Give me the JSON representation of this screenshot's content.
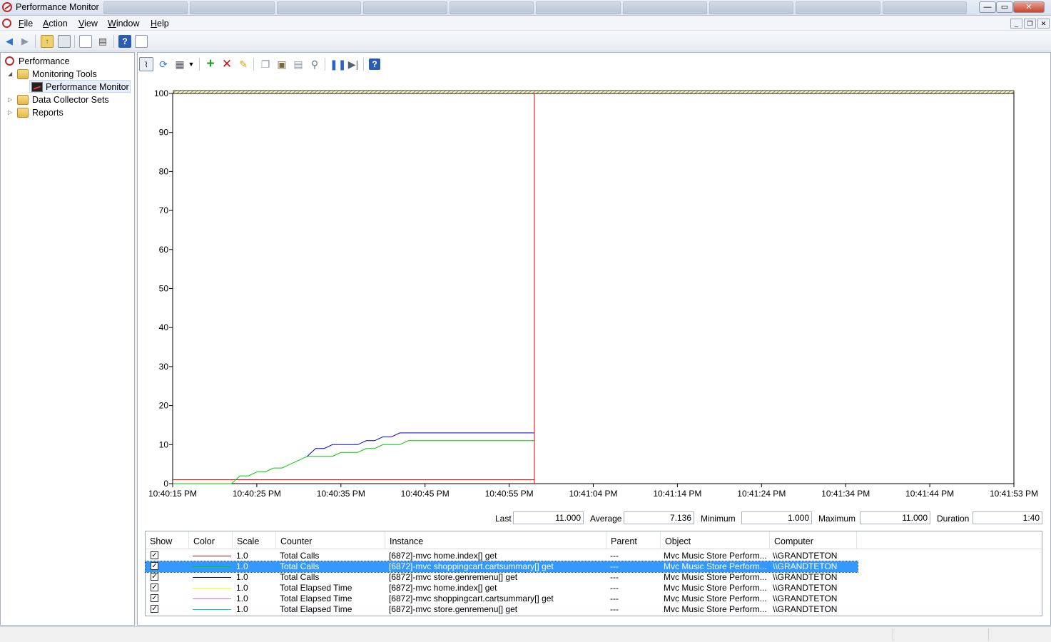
{
  "window": {
    "title": "Performance Monitor",
    "min_glyph": "—",
    "max_glyph": "▭",
    "close_glyph": "✕"
  },
  "menu": {
    "items": [
      {
        "accel": "F",
        "rest": "ile"
      },
      {
        "accel": "A",
        "rest": "ction"
      },
      {
        "accel": "V",
        "rest": "iew"
      },
      {
        "accel": "W",
        "rest": "indow"
      },
      {
        "accel": "H",
        "rest": "elp"
      }
    ]
  },
  "toolbar_icons": [
    "back-arrow-icon",
    "forward-arrow-icon",
    "folder-up-icon",
    "show-hide-console-tree-icon",
    "properties-icon",
    "print-icon",
    "help-icon",
    "action-pane-icon"
  ],
  "tree": {
    "items": [
      {
        "label": "Performance",
        "icon": "performance-icon"
      },
      {
        "label": "Monitoring Tools",
        "icon": "folder-icon"
      },
      {
        "label": "Performance Monitor",
        "icon": "performance-monitor-icon"
      },
      {
        "label": "Data Collector Sets",
        "icon": "folder-icon"
      },
      {
        "label": "Reports",
        "icon": "reports-icon"
      }
    ]
  },
  "content_tools": [
    "view-graph-icon",
    "view-current-activity-icon",
    "change-graph-type-icon",
    "dropdown-icon",
    "add-counter-icon",
    "delete-counter-icon",
    "highlight-icon",
    "copy-properties-icon",
    "paste-counter-list-icon",
    "properties-icon",
    "zoom-icon",
    "freeze-display-icon",
    "update-data-icon",
    "help-icon"
  ],
  "chart_data": {
    "type": "line",
    "ylim": [
      0,
      100
    ],
    "y_ticks": [
      0,
      10,
      20,
      30,
      40,
      50,
      60,
      70,
      80,
      90,
      100
    ],
    "x_tick_labels": [
      "10:40:15 PM",
      "10:40:25 PM",
      "10:40:35 PM",
      "10:40:45 PM",
      "10:40:55 PM",
      "10:41:04 PM",
      "10:41:14 PM",
      "10:41:24 PM",
      "10:41:34 PM",
      "10:41:44 PM",
      "10:41:53 PM"
    ],
    "x_samples": 100,
    "current_sample": 43,
    "grid": false,
    "series": [
      {
        "color": "#ff0000",
        "values": [
          [
            0,
            1
          ],
          [
            43,
            1
          ]
        ]
      },
      {
        "color": "#00cc00",
        "values": [
          [
            0,
            0
          ],
          [
            7,
            0
          ],
          [
            8,
            2
          ],
          [
            9,
            2
          ],
          [
            10,
            3
          ],
          [
            11,
            3
          ],
          [
            12,
            4
          ],
          [
            13,
            4
          ],
          [
            14,
            5
          ],
          [
            15,
            6
          ],
          [
            16,
            7
          ],
          [
            19,
            7
          ],
          [
            20,
            8
          ],
          [
            22,
            8
          ],
          [
            23,
            9
          ],
          [
            24,
            9
          ],
          [
            25,
            10
          ],
          [
            27,
            10
          ],
          [
            28,
            11
          ],
          [
            43,
            11
          ]
        ]
      },
      {
        "color": "#0000cc",
        "values": [
          [
            16,
            7
          ],
          [
            17,
            9
          ],
          [
            18,
            9
          ],
          [
            19,
            10
          ],
          [
            22,
            10
          ],
          [
            23,
            11
          ],
          [
            24,
            11
          ],
          [
            25,
            12
          ],
          [
            26,
            12
          ],
          [
            27,
            13
          ],
          [
            43,
            13
          ]
        ]
      }
    ]
  },
  "stats": {
    "last_label": "Last",
    "last": "11.000",
    "average_label": "Average",
    "average": "7.136",
    "minimum_label": "Minimum",
    "minimum": "1.000",
    "maximum_label": "Maximum",
    "maximum": "11.000",
    "duration_label": "Duration",
    "duration": "1:40"
  },
  "legend": {
    "headers": [
      "Show",
      "Color",
      "Scale",
      "Counter",
      "Instance",
      "Parent",
      "Object",
      "Computer"
    ],
    "check_glyph": "✓",
    "rows": [
      {
        "color": "#ff0000",
        "scale": "1.0",
        "counter": "Total Calls",
        "instance": "[6872]-mvc home.index[] get",
        "parent": "---",
        "object": "Mvc Music Store Perform...",
        "computer": "\\\\GRANDTETON",
        "selected": false
      },
      {
        "color": "#00cc00",
        "scale": "1.0",
        "counter": "Total Calls",
        "instance": "[6872]-mvc shoppingcart.cartsummary[] get",
        "parent": "---",
        "object": "Mvc Music Store Perform...",
        "computer": "\\\\GRANDTETON",
        "selected": true
      },
      {
        "color": "#0000cc",
        "scale": "1.0",
        "counter": "Total Calls",
        "instance": "[6872]-mvc store.genremenu[] get",
        "parent": "---",
        "object": "Mvc Music Store Perform...",
        "computer": "\\\\GRANDTETON",
        "selected": false
      },
      {
        "color": "#ffff00",
        "scale": "1.0",
        "counter": "Total Elapsed Time",
        "instance": "[6872]-mvc home.index[] get",
        "parent": "---",
        "object": "Mvc Music Store Perform...",
        "computer": "\\\\GRANDTETON",
        "selected": false
      },
      {
        "color": "#ff6699",
        "scale": "1.0",
        "counter": "Total Elapsed Time",
        "instance": "[6872]-mvc shoppingcart.cartsummary[] get",
        "parent": "---",
        "object": "Mvc Music Store Perform...",
        "computer": "\\\\GRANDTETON",
        "selected": false
      },
      {
        "color": "#00cccc",
        "scale": "1.0",
        "counter": "Total Elapsed Time",
        "instance": "[6872]-mvc store.genremenu[] get",
        "parent": "---",
        "object": "Mvc Music Store Perform...",
        "computer": "\\\\GRANDTETON",
        "selected": false
      }
    ]
  }
}
